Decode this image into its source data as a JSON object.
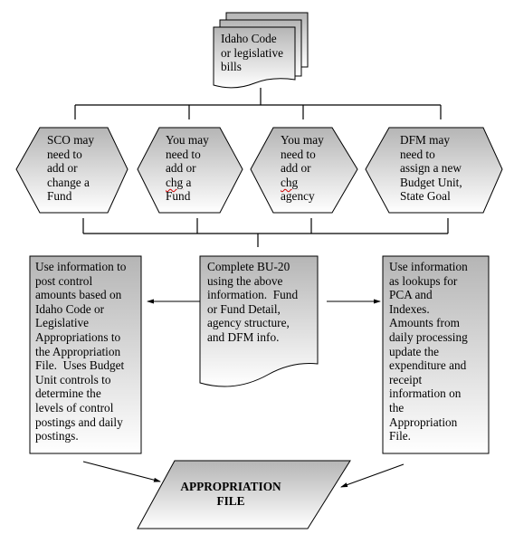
{
  "source": {
    "lines": [
      "Idaho Code",
      "or legislative",
      "bills"
    ]
  },
  "hexagons": [
    {
      "lines": [
        "SCO may",
        "need to",
        "add or",
        "change a",
        "Fund"
      ],
      "misspelled": ""
    },
    {
      "lines": [
        "You may",
        "need to",
        "add or",
        "chg a",
        "Fund"
      ],
      "misspelled": "chg"
    },
    {
      "lines": [
        "You may",
        "need to",
        "add or",
        "chg",
        "agency"
      ],
      "misspelled": "chg"
    },
    {
      "lines": [
        "DFM may",
        "need to",
        "assign a new",
        "Budget Unit,",
        "State Goal"
      ],
      "misspelled": ""
    }
  ],
  "left_box": {
    "lines": [
      "Use information to",
      "post control",
      "amounts based on",
      "Idaho Code or",
      "Legislative",
      "Appropriations to",
      "the Appropriation",
      "File.  Uses Budget",
      "Unit controls to",
      "determine the",
      "levels of control",
      "postings and daily",
      "postings."
    ]
  },
  "center_doc": {
    "lines": [
      "Complete BU-20",
      "using the above",
      "information.  Fund",
      "or Fund Detail,",
      "agency structure,",
      "and DFM info."
    ]
  },
  "right_box": {
    "lines": [
      "Use information",
      "as lookups for",
      "PCA and",
      "Indexes.",
      "Amounts from",
      "daily processing",
      "update the",
      "expenditure and",
      "receipt",
      "information on",
      "the",
      "Appropriation",
      "File."
    ]
  },
  "output_file": {
    "lines": [
      "APPROPRIATION",
      "FILE"
    ]
  },
  "colors": {
    "gradient_top": "#b8b8b8",
    "gradient_bottom": "#ffffff",
    "stroke": "#000000",
    "spellcheck": "#d00000"
  }
}
